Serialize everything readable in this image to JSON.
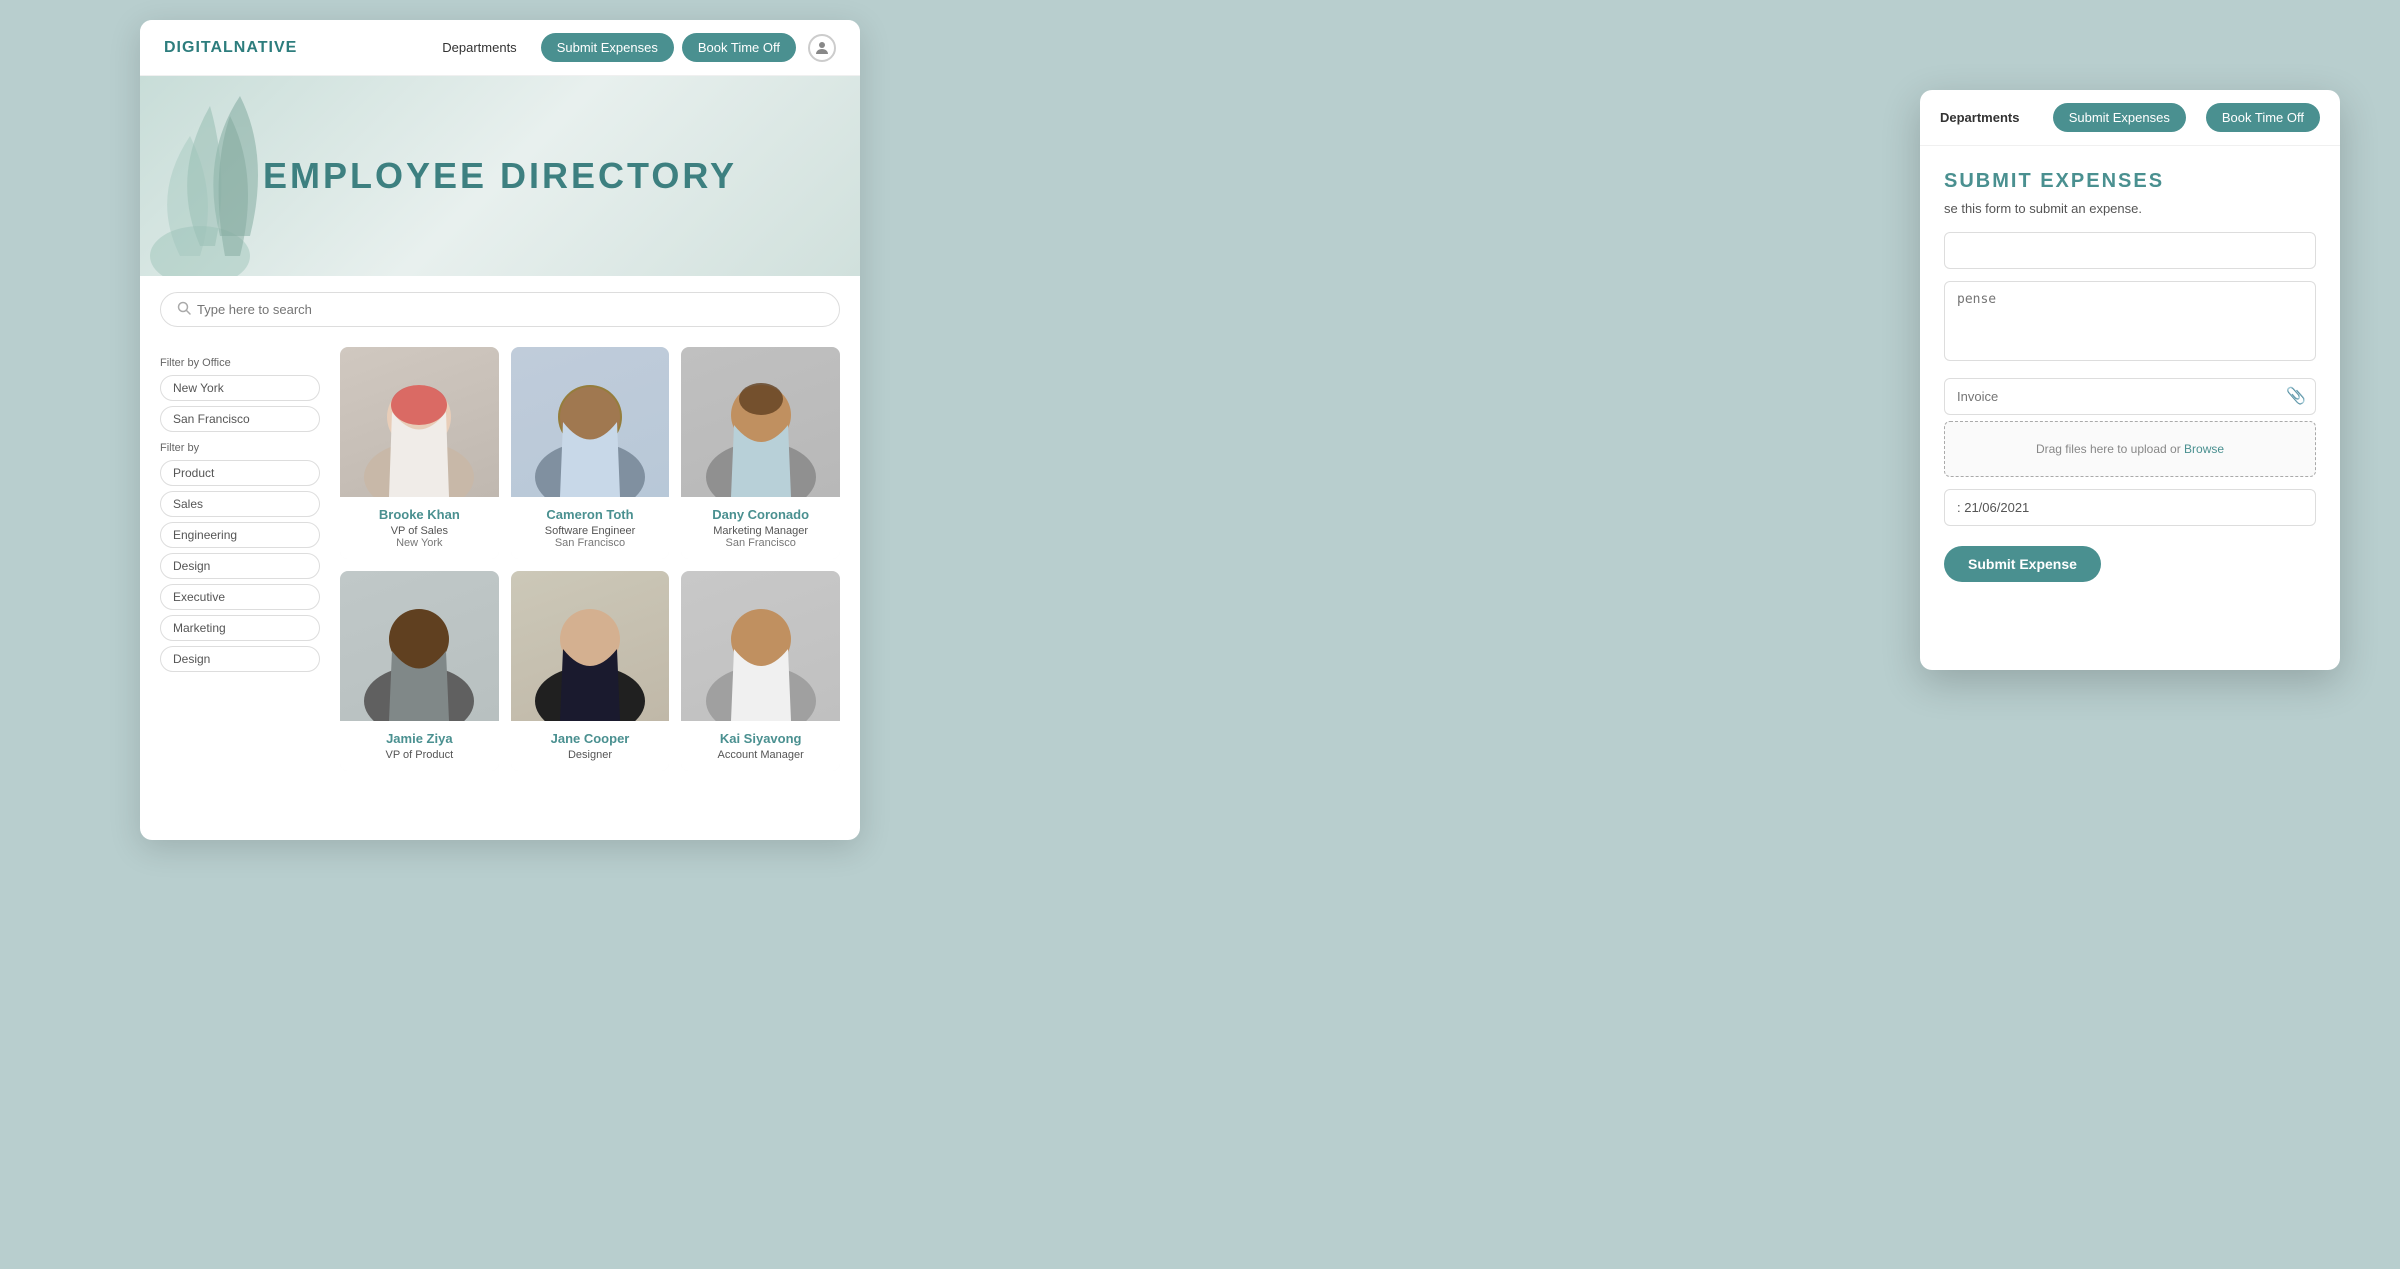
{
  "brand": {
    "name": "DIGITALNATIVE"
  },
  "navbar": {
    "departments_label": "Departments",
    "submit_expenses_label": "Submit Expenses",
    "book_time_off_label": "Book Time Off"
  },
  "hero": {
    "title": "EMPLOYEE DIRECTORY"
  },
  "search": {
    "placeholder": "Type here to search"
  },
  "filters": {
    "office_label": "Filter by Office",
    "office_items": [
      "New York",
      "San Francisco"
    ],
    "dept_label": "Filter by",
    "dept_items": [
      "Product",
      "Sales",
      "Engineering",
      "Design",
      "Executive",
      "Marketing",
      "Design"
    ]
  },
  "employees": [
    {
      "name": "Brooke Khan",
      "role": "VP of Sales",
      "location": "New York",
      "photo_bg": "#d8cfc6",
      "emoji": "👩‍🦰"
    },
    {
      "name": "Cameron Toth",
      "role": "Software Engineer",
      "location": "San Francisco",
      "photo_bg": "#c8d4dc",
      "emoji": "👨🏾"
    },
    {
      "name": "Dany Coronado",
      "role": "Marketing Manager",
      "location": "San Francisco",
      "photo_bg": "#c4c4c4",
      "emoji": "👨🏽"
    },
    {
      "name": "Jamie Ziya",
      "role": "VP of Product",
      "location": "",
      "photo_bg": "#c8cfcf",
      "emoji": "👨🏿"
    },
    {
      "name": "Jane Cooper",
      "role": "Designer",
      "location": "",
      "photo_bg": "#d0c8b5",
      "emoji": "👩🏼"
    },
    {
      "name": "Kai Siyavong",
      "role": "Account Manager",
      "location": "",
      "photo_bg": "#c8c8c8",
      "emoji": "👨"
    }
  ],
  "overlay": {
    "nav_departments": "Departments",
    "nav_submit": "Submit Expenses",
    "nav_book": "Book Time Off",
    "title": "SUBMIT EXPENSES",
    "subtitle": "se this form to submit an expense.",
    "select_placeholder": "",
    "expense_label": "pense",
    "invoice_label": "Invoice",
    "upload_text": "Drag files here to upload or",
    "upload_browse": "Browse",
    "date_value": ": 21/06/2021",
    "submit_label": "Submit Expense"
  }
}
